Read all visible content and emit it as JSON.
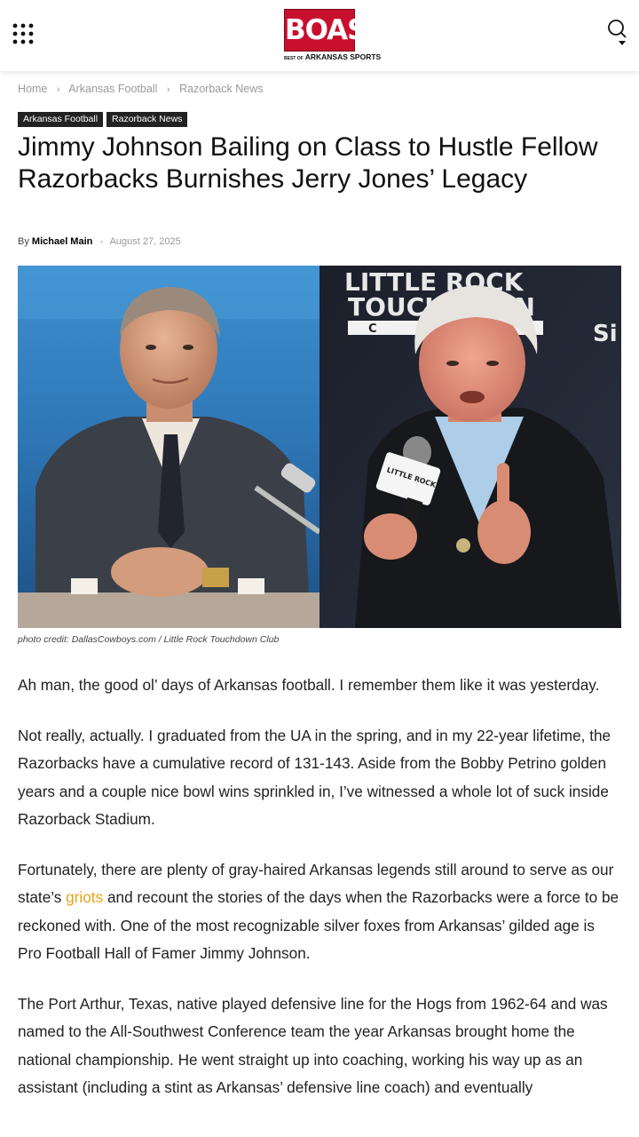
{
  "header": {
    "logo_text": "BOAS",
    "logo_sub_small": "BEST OF",
    "logo_sub_big": "ARKANSAS SPORTS",
    "menu_icon": "grid-dots-icon",
    "search_icon": "search-icon"
  },
  "breadcrumb": [
    "Home",
    "Arkansas Football",
    "Razorback News"
  ],
  "tags": [
    "Arkansas Football",
    "Razorback News"
  ],
  "article": {
    "title": "Jimmy Johnson Bailing on Class to Hustle Fellow Razorbacks Burnishes Jerry Jones’ Legacy",
    "by_label": "By",
    "author": "Michael Main",
    "separator": "-",
    "date": "August 27, 2025",
    "image": {
      "sign_line1": "LITTLE ROCK",
      "sign_line2": "TOUCHDOWN",
      "sign_line3": "C",
      "mic_text": "LITTLE ROCK"
    },
    "photo_credit": "photo credit: DallasCowboys.com / Little Rock Touchdown Club",
    "p1": "Ah man, the good ol’ days of Arkansas football. I remember them like it was yesterday.",
    "p2": "Not really, actually. I graduated from the UA in the spring, and in my 22-year lifetime, the Razorbacks have a cumulative record of 131-143. Aside from the Bobby Petrino golden years and a couple nice bowl wins sprinkled in, I’ve witnessed a whole lot of suck inside Razorback Stadium.",
    "p3_before": "Fortunately, there are plenty of gray-haired Arkansas legends still around to serve as our state’s ",
    "p3_link": "griots",
    "p3_after": " and recount the stories of the days when the Razorbacks were a force to be reckoned with. One of the most recognizable silver foxes from Arkansas’ gilded age is Pro Football Hall of Famer Jimmy Johnson.",
    "p4": "The Port Arthur, Texas, native played defensive line for the Hogs from 1962-64 and was named to the All-Southwest Conference team the year Arkansas brought home the national championship. He went straight up into coaching, working his way up as an assistant (including a stint as Arkansas’ defensive line coach) and eventually"
  },
  "colors": {
    "brand_red": "#c8102e",
    "link": "#e8a31c",
    "tag_bg": "#222222"
  }
}
